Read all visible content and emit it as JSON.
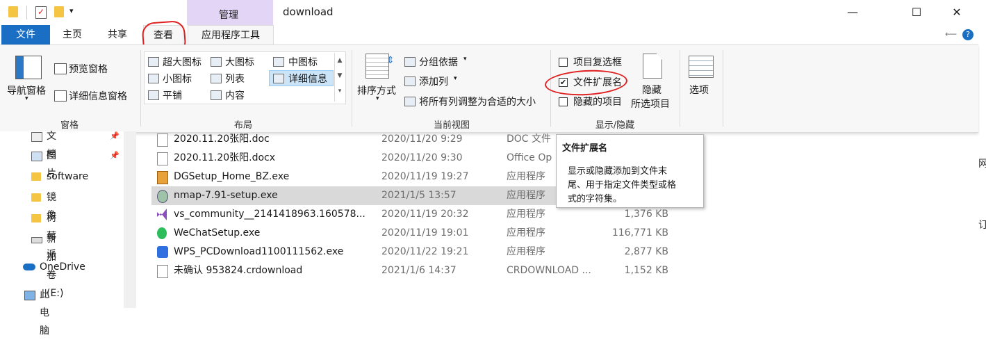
{
  "window": {
    "title": "download",
    "context_tab_group": "管理",
    "minimize": "—",
    "maximize": "☐",
    "close": "✕"
  },
  "tabs": {
    "file": "文件",
    "home": "主页",
    "share": "共享",
    "view": "查看",
    "app_tools": "应用程序工具"
  },
  "ribbon": {
    "panes": {
      "label": "窗格",
      "nav_pane": "导航窗格",
      "preview_pane": "预览窗格",
      "details_pane": "详细信息窗格"
    },
    "layout": {
      "label": "布局",
      "items": [
        "超大图标",
        "大图标",
        "中图标",
        "小图标",
        "列表",
        "详细信息",
        "平铺",
        "内容"
      ],
      "selected": "详细信息"
    },
    "current_view": {
      "label": "当前视图",
      "sort_by": "排序方式",
      "group_by": "分组依据",
      "add_columns": "添加列",
      "size_all_columns": "将所有列调整为合适的大小"
    },
    "show_hide": {
      "label": "显示/隐藏",
      "item_checkboxes": "项目复选框",
      "item_checkboxes_checked": false,
      "file_name_extensions": "文件扩展名",
      "file_name_extensions_checked": true,
      "hidden_items": "隐藏的项目",
      "hidden_items_checked": false,
      "hide_selected_line1": "隐藏",
      "hide_selected_line2": "所选项目"
    },
    "options": "选项"
  },
  "nav_pane": {
    "items": [
      {
        "label": "文档",
        "pinned": true,
        "icon": "documents-icon"
      },
      {
        "label": "图片",
        "pinned": true,
        "icon": "pictures-icon"
      },
      {
        "label": "software",
        "pinned": false,
        "icon": "folder-icon"
      },
      {
        "label": "镜像",
        "pinned": false,
        "icon": "folder-icon"
      },
      {
        "label": "树莓派",
        "pinned": false,
        "icon": "folder-icon"
      },
      {
        "label": "新加卷 (E:)",
        "pinned": false,
        "icon": "drive-icon"
      },
      {
        "label": "OneDrive",
        "pinned": false,
        "icon": "onedrive-icon"
      },
      {
        "label": "此电脑",
        "pinned": false,
        "icon": "computer-icon"
      }
    ]
  },
  "files": [
    {
      "name": "2020.11.20张阳.doc",
      "date": "2020/11/20 9:29",
      "type": "DOC 文件",
      "size": "",
      "icon": "document-icon"
    },
    {
      "name": "2020.11.20张阳.docx",
      "date": "2020/11/20 9:30",
      "type": "Office Op",
      "size": "",
      "icon": "document-icon"
    },
    {
      "name": "DGSetup_Home_BZ.exe",
      "date": "2020/11/19 19:27",
      "type": "应用程序",
      "size": "",
      "icon": "installer-icon"
    },
    {
      "name": "nmap-7.91-setup.exe",
      "date": "2021/1/5 13:57",
      "type": "应用程序",
      "size": "",
      "icon": "installer-icon",
      "selected": true
    },
    {
      "name": "vs_community__2141418963.160578...",
      "date": "2020/11/19 20:32",
      "type": "应用程序",
      "size": "1,376 KB",
      "icon": "visual-studio-icon"
    },
    {
      "name": "WeChatSetup.exe",
      "date": "2020/11/19 19:01",
      "type": "应用程序",
      "size": "116,771 KB",
      "icon": "wechat-icon"
    },
    {
      "name": "WPS_PCDownload1100111562.exe",
      "date": "2020/11/22 19:21",
      "type": "应用程序",
      "size": "2,877 KB",
      "icon": "wps-icon"
    },
    {
      "name": "未确认 953824.crdownload",
      "date": "2021/1/6 14:37",
      "type": "CRDOWNLOAD ...",
      "size": "1,152 KB",
      "icon": "document-icon"
    }
  ],
  "tooltip": {
    "title": "文件扩展名",
    "line1": "显示或隐藏添加到文件末",
    "line2": "尾、用于指定文件类型或格",
    "line3": "式的字符集。"
  },
  "edge_fragments": {
    "a": "网",
    "b": "订"
  },
  "colors": {
    "file_tab": "#1a6fc4",
    "context_tab": "#e3d5f5",
    "annotation": "#e02020",
    "selection": "#cce4f7"
  }
}
